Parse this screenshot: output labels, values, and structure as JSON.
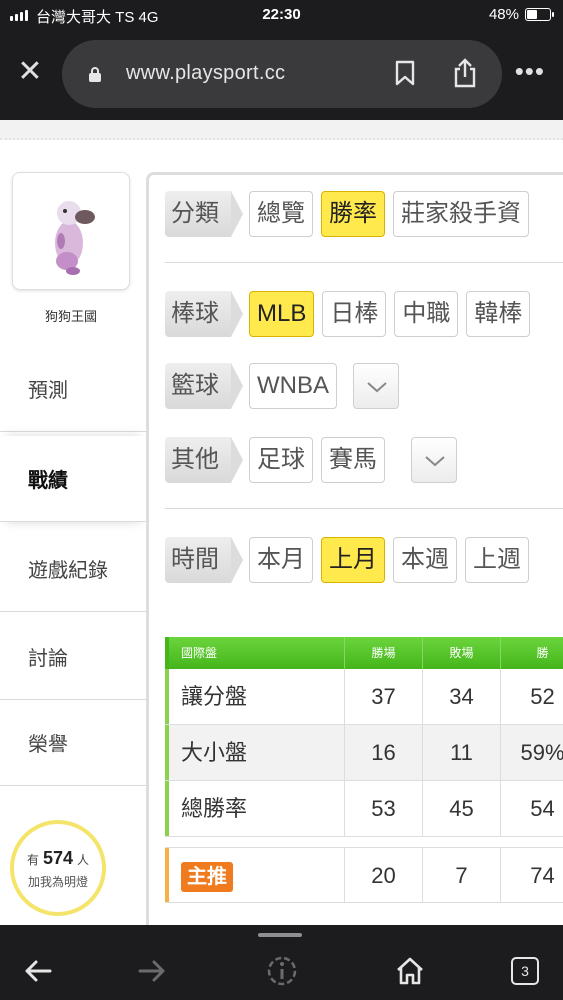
{
  "status_bar": {
    "carrier": "台灣大哥大 TS   4G",
    "time": "22:30",
    "battery": "48%",
    "battery_level": 0.48
  },
  "browser": {
    "url": "www.playsport.cc",
    "tab_count": "3"
  },
  "sidebar": {
    "username": "狗狗王國",
    "nav": [
      {
        "label": "預測"
      },
      {
        "label": "戰績"
      },
      {
        "label": "遊戲紀錄"
      },
      {
        "label": "討論"
      },
      {
        "label": "榮譽"
      }
    ],
    "fans": {
      "prefix": "有",
      "count": "574",
      "suffix": "人",
      "line2": "加我為明燈"
    }
  },
  "filters": {
    "category": {
      "tag": "分類",
      "options": [
        "總覽",
        "勝率",
        "莊家殺手資"
      ],
      "selected": "勝率"
    },
    "baseball": {
      "tag": "棒球",
      "options": [
        "MLB",
        "日棒",
        "中職",
        "韓棒"
      ],
      "selected": "MLB"
    },
    "basketball": {
      "tag": "籃球",
      "options": [
        "WNBA"
      ]
    },
    "other": {
      "tag": "其他",
      "options": [
        "足球",
        "賽馬"
      ]
    },
    "time": {
      "tag": "時間",
      "options": [
        "本月",
        "上月",
        "本週",
        "上週"
      ],
      "selected": "上月"
    }
  },
  "table": {
    "headers": [
      "國際盤",
      "勝場",
      "敗場",
      "勝"
    ],
    "rows": [
      {
        "name": "讓分盤",
        "win": "37",
        "lose": "34",
        "rate": "52"
      },
      {
        "name": "大小盤",
        "win": "16",
        "lose": "11",
        "rate": "59%"
      },
      {
        "name": "總勝率",
        "win": "53",
        "lose": "45",
        "rate": "54"
      }
    ],
    "recommend": {
      "badge": "主推",
      "win": "20",
      "lose": "7",
      "rate": "74"
    }
  },
  "colors": {
    "selected_option": "#ffe94c",
    "table_header": "#45b51c",
    "badge": "#f07b1e",
    "chrome_dark": "#1c1c1e"
  }
}
